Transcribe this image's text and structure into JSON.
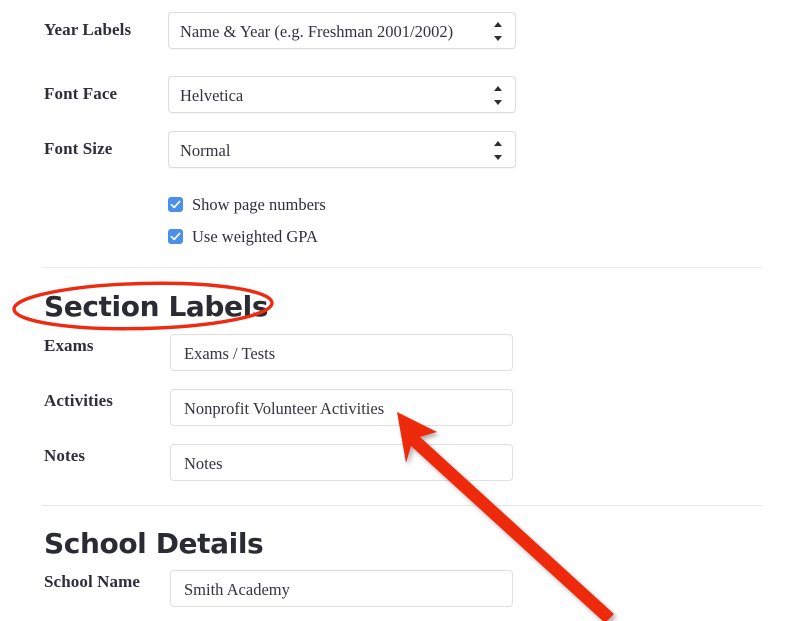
{
  "form": {
    "rows": [
      {
        "label": "Year Labels",
        "control": "select",
        "value": "Name & Year (e.g. Freshman 2001/2002)",
        "name": "year-labels"
      },
      {
        "label": "Font Face",
        "control": "select",
        "value": "Helvetica",
        "name": "font-face"
      },
      {
        "label": "Font Size",
        "control": "select",
        "value": "Normal",
        "name": "font-size"
      }
    ],
    "checkboxes": [
      {
        "label": "Show page numbers",
        "checked": true,
        "name": "show-page-numbers"
      },
      {
        "label": "Use weighted GPA",
        "checked": true,
        "name": "use-weighted-gpa"
      }
    ]
  },
  "section_labels": {
    "heading": "Section Labels",
    "rows": [
      {
        "label": "Exams",
        "value": "Exams / Tests",
        "name": "exams"
      },
      {
        "label": "Activities",
        "value": "Nonprofit Volunteer Activities",
        "name": "activities"
      },
      {
        "label": "Notes",
        "value": "Notes",
        "name": "notes"
      }
    ]
  },
  "school_details": {
    "heading": "School Details",
    "rows": [
      {
        "label": "School Name",
        "value": "Smith Academy",
        "name": "school-name"
      }
    ]
  },
  "annotations": {
    "highlight_color": "#ee2b11",
    "ellipse_target": "Section Labels",
    "arrow_target": "Nonprofit Volunteer Activities"
  },
  "colors": {
    "checkbox_blue": "#4a90e8",
    "text_dark": "#2f2f38",
    "border": "#e0e0e0",
    "divider": "#e8e8e8",
    "annotation_red": "#ee2b11"
  }
}
